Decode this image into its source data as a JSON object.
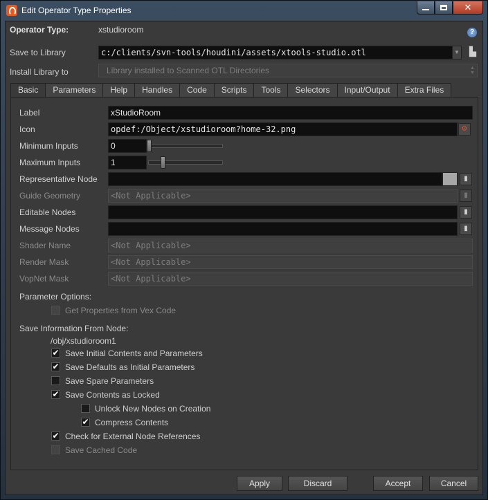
{
  "window": {
    "title": "Edit Operator Type Properties"
  },
  "header": {
    "operator_type_label": "Operator Type:",
    "operator_type_value": "xstudioroom",
    "save_to_library_label": "Save to Library",
    "save_to_library_value": "c:/clients/svn-tools/houdini/assets/xtools-studio.otl",
    "install_library_label": "Install Library to",
    "install_library_value": "Library installed to Scanned OTL Directories"
  },
  "tabs": [
    "Basic",
    "Parameters",
    "Help",
    "Handles",
    "Code",
    "Scripts",
    "Tools",
    "Selectors",
    "Input/Output",
    "Extra Files"
  ],
  "basic": {
    "label_label": "Label",
    "label_value": "xStudioRoom",
    "icon_label": "Icon",
    "icon_value": "opdef:/Object/xstudioroom?home-32.png",
    "min_inputs_label": "Minimum Inputs",
    "min_inputs_value": "0",
    "max_inputs_label": "Maximum Inputs",
    "max_inputs_value": "1",
    "rep_node_label": "Representative Node",
    "rep_node_value": "",
    "guide_geometry_label": "Guide Geometry",
    "guide_geometry_value": "<Not Applicable>",
    "editable_nodes_label": "Editable Nodes",
    "editable_nodes_value": "",
    "message_nodes_label": "Message Nodes",
    "message_nodes_value": "",
    "shader_name_label": "Shader Name",
    "shader_name_value": "<Not Applicable>",
    "render_mask_label": "Render Mask",
    "render_mask_value": "<Not Applicable>",
    "vopnet_mask_label": "VopNet Mask",
    "vopnet_mask_value": "<Not Applicable>",
    "param_options_label": "Parameter Options:",
    "get_props_vex_label": "Get Properties from Vex Code",
    "save_info_label": "Save Information From Node:",
    "node_path": "/obj/xstudioroom1",
    "save_initial_label": "Save Initial Contents and Parameters",
    "save_defaults_label": "Save Defaults as Initial Parameters",
    "save_spare_label": "Save Spare Parameters",
    "save_locked_label": "Save Contents as Locked",
    "unlock_new_label": "Unlock New Nodes on Creation",
    "compress_label": "Compress Contents",
    "check_external_label": "Check for External Node References",
    "save_cached_label": "Save Cached Code"
  },
  "checks": {
    "get_props_vex": false,
    "save_initial": true,
    "save_defaults": true,
    "save_spare": false,
    "save_locked": true,
    "unlock_new": false,
    "compress": true,
    "check_external": true,
    "save_cached": false
  },
  "sliders": {
    "min_inputs_fraction": 0.0,
    "max_inputs_fraction": 0.18
  },
  "footer": {
    "apply": "Apply",
    "discard": "Discard",
    "accept": "Accept",
    "cancel": "Cancel"
  },
  "icons": {
    "help": "help-icon",
    "library": "library-icon",
    "browse": "file-browse-icon",
    "node_picker": "node-picker-icon"
  },
  "colors": {
    "rep_node_swatch": "#a7a7a7",
    "app_icon": "#e8581f"
  }
}
